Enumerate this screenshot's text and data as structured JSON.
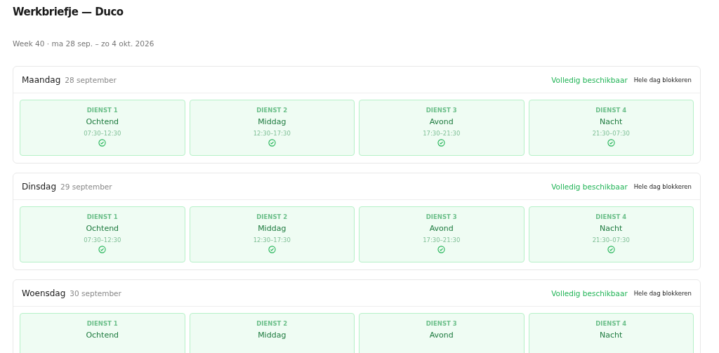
{
  "title": "Werkbriefje — Duco",
  "subtitle": "Week 40 · ma 28 sep. – zo 4 okt. 2026",
  "days": [
    {
      "name": "Maandag",
      "date": "28 september",
      "status": "Volledig beschikbaar",
      "action": "Hele dag blokkeren",
      "slots": [
        {
          "label": "DIENST 1",
          "name": "Ochtend",
          "time": "07:30–12:30",
          "available": true
        },
        {
          "label": "DIENST 2",
          "name": "Middag",
          "time": "12:30–17:30",
          "available": true
        },
        {
          "label": "DIENST 3",
          "name": "Avond",
          "time": "17:30–21:30",
          "available": true
        },
        {
          "label": "DIENST 4",
          "name": "Nacht",
          "time": "21:30–07:30",
          "available": true
        }
      ]
    },
    {
      "name": "Dinsdag",
      "date": "29 september",
      "status": "Volledig beschikbaar",
      "action": "Hele dag blokkeren",
      "slots": [
        {
          "label": "DIENST 1",
          "name": "Ochtend",
          "time": "07:30–12:30",
          "available": true
        },
        {
          "label": "DIENST 2",
          "name": "Middag",
          "time": "12:30–17:30",
          "available": true
        },
        {
          "label": "DIENST 3",
          "name": "Avond",
          "time": "17:30–21:30",
          "available": true
        },
        {
          "label": "DIENST 4",
          "name": "Nacht",
          "time": "21:30–07:30",
          "available": true
        }
      ]
    },
    {
      "name": "Woensdag",
      "date": "30 september",
      "status": "Volledig beschikbaar",
      "action": "Hele dag blokkeren",
      "slots": [
        {
          "label": "DIENST 1",
          "name": "Ochtend",
          "available": true
        },
        {
          "label": "DIENST 2",
          "name": "Middag",
          "available": true
        },
        {
          "label": "DIENST 3",
          "name": "Avond",
          "available": true
        },
        {
          "label": "DIENST 4",
          "name": "Nacht",
          "available": true
        }
      ]
    }
  ]
}
